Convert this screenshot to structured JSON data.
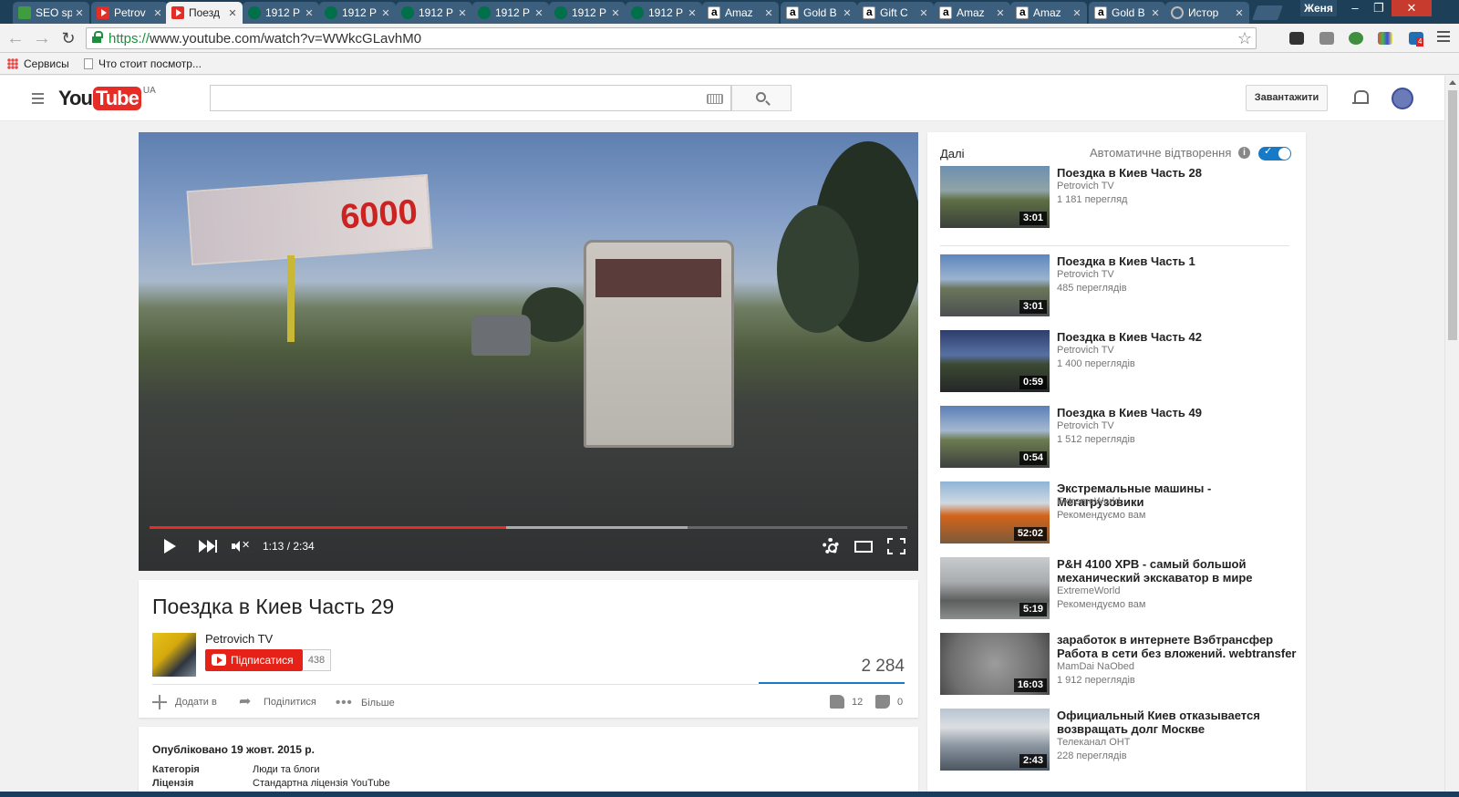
{
  "browser": {
    "tabs": [
      {
        "label": "SEO sp",
        "icon": "seo-favicon",
        "active": false
      },
      {
        "label": "Petrov",
        "icon": "youtube-favicon",
        "active": false
      },
      {
        "label": "Поезд",
        "icon": "youtube-favicon",
        "active": true
      },
      {
        "label": "1912 P",
        "icon": "starbucks-favicon",
        "active": false
      },
      {
        "label": "1912 P",
        "icon": "starbucks-favicon",
        "active": false
      },
      {
        "label": "1912 P",
        "icon": "starbucks-favicon",
        "active": false
      },
      {
        "label": "1912 P",
        "icon": "starbucks-favicon",
        "active": false
      },
      {
        "label": "1912 P",
        "icon": "starbucks-favicon",
        "active": false
      },
      {
        "label": "1912 P",
        "icon": "starbucks-favicon",
        "active": false
      },
      {
        "label": "Amaz",
        "icon": "amazon-favicon",
        "active": false
      },
      {
        "label": "Gold B",
        "icon": "amazon-favicon",
        "active": false
      },
      {
        "label": "Gift C",
        "icon": "amazon-favicon",
        "active": false
      },
      {
        "label": "Amaz",
        "icon": "amazon-favicon",
        "active": false
      },
      {
        "label": "Amaz",
        "icon": "amazon-favicon",
        "active": false
      },
      {
        "label": "Gold B",
        "icon": "amazon-favicon",
        "active": false
      },
      {
        "label": "Истор",
        "icon": "history-favicon",
        "active": false
      }
    ],
    "profile_name": "Женя",
    "url_scheme": "https://",
    "url_rest": "www.youtube.com/watch?v=WWkcGLavhM0",
    "bookmarks": [
      "Сервисы",
      "Что стоит посмотр..."
    ],
    "extension_badge": "4"
  },
  "header": {
    "logo_you": "You",
    "logo_tube": "Tube",
    "logo_region": "UA",
    "search_placeholder": "",
    "upload_label": "Завантажити"
  },
  "player": {
    "time_display": "1:13 / 2:34",
    "played_fraction": 0.47,
    "buffered_fraction": 0.71,
    "billboard_text": "6000",
    "accent": "#e52d27"
  },
  "video": {
    "title": "Поездка в Киев Часть 29",
    "channel": "Petrovich TV",
    "subscribe_label": "Підписатися",
    "subscriber_count": "438",
    "views": "2 284",
    "add_label": "Додати в",
    "share_label": "Поділитися",
    "more_label": "Більше",
    "likes": "12",
    "dislikes": "0",
    "published": "Опубліковано 19 жовт. 2015 р.",
    "meta": [
      {
        "key": "Категорія",
        "value": "Люди та блоги"
      },
      {
        "key": "Ліцензія",
        "value": "Стандартна ліцензія YouTube"
      }
    ]
  },
  "sidebar": {
    "next_label": "Далі",
    "autoplay_label": "Автоматичне відтворення",
    "autoplay_on": true,
    "items": [
      {
        "title": "Поездка в Киев Часть 28",
        "channel": "Petrovich TV",
        "meta": "1 181 перегляд",
        "duration": "3:01",
        "thumb": "road-truck"
      },
      {
        "title": "Поездка в Киев Часть 1",
        "channel": "Petrovich TV",
        "meta": "485 переглядів",
        "duration": "3:01",
        "thumb": "highway"
      },
      {
        "title": "Поездка в Киев Часть 42",
        "channel": "Petrovich TV",
        "meta": "1 400 переглядів",
        "duration": "0:59",
        "thumb": "dusk-road"
      },
      {
        "title": "Поездка в Киев Часть 49",
        "channel": "Petrovich TV",
        "meta": "1 512 переглядів",
        "duration": "0:54",
        "thumb": "field-road"
      },
      {
        "title": "Экстремальные машины - Мегагрузовики",
        "channel": "ExtremeWorld",
        "meta": "Рекомендуємо вам",
        "duration": "52:02",
        "thumb": "orange-truck"
      },
      {
        "title": "P&H 4100 XPB - самый большой механический экскаватор в мире",
        "channel": "ExtremeWorld",
        "meta": "Рекомендуємо вам",
        "duration": "5:19",
        "thumb": "excavator"
      },
      {
        "title": "заработок в интернете Вэбтрансфер Работа в сети без вложений. webtransfer",
        "channel": "MamDai NaObed",
        "meta": "1 912 переглядів",
        "duration": "16:03",
        "thumb": "warning"
      },
      {
        "title": "Официальный Киев отказывается возвращать долг Москве",
        "channel": "Телеканал ОНТ",
        "meta": "228 переглядів",
        "duration": "2:43",
        "thumb": "building"
      }
    ]
  }
}
